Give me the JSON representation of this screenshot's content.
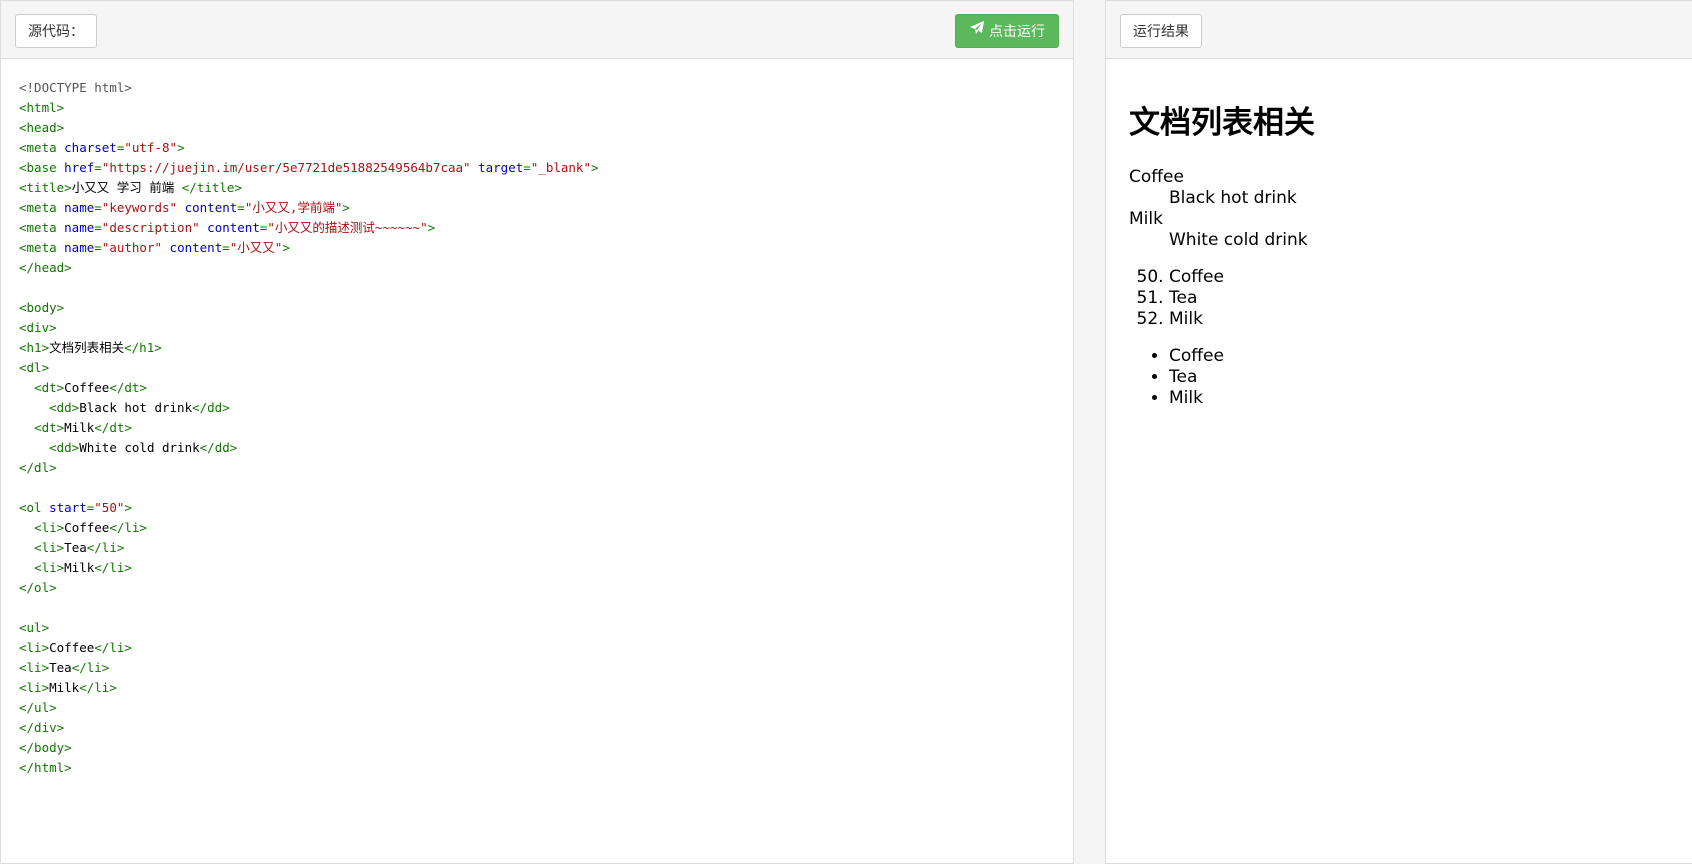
{
  "left_panel": {
    "label_button": "源代码：",
    "run_button": "点击运行",
    "code_lines": [
      [
        [
          "meta",
          "<!DOCTYPE html>"
        ]
      ],
      [
        [
          "tag",
          "<html>"
        ]
      ],
      [
        [
          "tag",
          "<head>"
        ]
      ],
      [
        [
          "tag",
          "<meta "
        ],
        [
          "attr",
          "charset"
        ],
        [
          "tag",
          "="
        ],
        [
          "str",
          "\"utf-8\""
        ],
        [
          "tag",
          ">"
        ]
      ],
      [
        [
          "tag",
          "<base "
        ],
        [
          "attr",
          "href"
        ],
        [
          "tag",
          "="
        ],
        [
          "str",
          "\"https://juejin.im/user/5e7721de51882549564b7caa\""
        ],
        [
          "tag",
          " "
        ],
        [
          "attr",
          "target"
        ],
        [
          "tag",
          "="
        ],
        [
          "str",
          "\"_blank\""
        ],
        [
          "tag",
          ">"
        ]
      ],
      [
        [
          "tag",
          "<title>"
        ],
        [
          "txt",
          "小又又 学习 前端 "
        ],
        [
          "tag",
          "</title>"
        ]
      ],
      [
        [
          "tag",
          "<meta "
        ],
        [
          "attr",
          "name"
        ],
        [
          "tag",
          "="
        ],
        [
          "str",
          "\"keywords\""
        ],
        [
          "tag",
          " "
        ],
        [
          "attr",
          "content"
        ],
        [
          "tag",
          "="
        ],
        [
          "str",
          "\"小又又,学前端\""
        ],
        [
          "tag",
          ">"
        ]
      ],
      [
        [
          "tag",
          "<meta "
        ],
        [
          "attr",
          "name"
        ],
        [
          "tag",
          "="
        ],
        [
          "str",
          "\"description\""
        ],
        [
          "tag",
          " "
        ],
        [
          "attr",
          "content"
        ],
        [
          "tag",
          "="
        ],
        [
          "str",
          "\"小又又的描述测试~~~~~~\""
        ],
        [
          "tag",
          ">"
        ]
      ],
      [
        [
          "tag",
          "<meta "
        ],
        [
          "attr",
          "name"
        ],
        [
          "tag",
          "="
        ],
        [
          "str",
          "\"author\""
        ],
        [
          "tag",
          " "
        ],
        [
          "attr",
          "content"
        ],
        [
          "tag",
          "="
        ],
        [
          "str",
          "\"小又又\""
        ],
        [
          "tag",
          ">"
        ]
      ],
      [
        [
          "tag",
          "</head>"
        ]
      ],
      [],
      [
        [
          "tag",
          "<body>"
        ]
      ],
      [
        [
          "tag",
          "<div>"
        ]
      ],
      [
        [
          "tag",
          "<h1>"
        ],
        [
          "txt",
          "文档列表相关"
        ],
        [
          "tag",
          "</h1>"
        ]
      ],
      [
        [
          "tag",
          "<dl>"
        ]
      ],
      [
        [
          "txt",
          "  "
        ],
        [
          "tag",
          "<dt>"
        ],
        [
          "txt",
          "Coffee"
        ],
        [
          "tag",
          "</dt>"
        ]
      ],
      [
        [
          "txt",
          "    "
        ],
        [
          "tag",
          "<dd>"
        ],
        [
          "txt",
          "Black hot drink"
        ],
        [
          "tag",
          "</dd>"
        ]
      ],
      [
        [
          "txt",
          "  "
        ],
        [
          "tag",
          "<dt>"
        ],
        [
          "txt",
          "Milk"
        ],
        [
          "tag",
          "</dt>"
        ]
      ],
      [
        [
          "txt",
          "    "
        ],
        [
          "tag",
          "<dd>"
        ],
        [
          "txt",
          "White cold drink"
        ],
        [
          "tag",
          "</dd>"
        ]
      ],
      [
        [
          "tag",
          "</dl>"
        ]
      ],
      [],
      [
        [
          "tag",
          "<ol "
        ],
        [
          "attr",
          "start"
        ],
        [
          "tag",
          "="
        ],
        [
          "str",
          "\"50\""
        ],
        [
          "tag",
          ">"
        ]
      ],
      [
        [
          "txt",
          "  "
        ],
        [
          "tag",
          "<li>"
        ],
        [
          "txt",
          "Coffee"
        ],
        [
          "tag",
          "</li>"
        ]
      ],
      [
        [
          "txt",
          "  "
        ],
        [
          "tag",
          "<li>"
        ],
        [
          "txt",
          "Tea"
        ],
        [
          "tag",
          "</li>"
        ]
      ],
      [
        [
          "txt",
          "  "
        ],
        [
          "tag",
          "<li>"
        ],
        [
          "txt",
          "Milk"
        ],
        [
          "tag",
          "</li>"
        ]
      ],
      [
        [
          "tag",
          "</ol>"
        ]
      ],
      [],
      [
        [
          "tag",
          "<ul>"
        ]
      ],
      [
        [
          "tag",
          "<li>"
        ],
        [
          "txt",
          "Coffee"
        ],
        [
          "tag",
          "</li>"
        ]
      ],
      [
        [
          "tag",
          "<li>"
        ],
        [
          "txt",
          "Tea"
        ],
        [
          "tag",
          "</li>"
        ]
      ],
      [
        [
          "tag",
          "<li>"
        ],
        [
          "txt",
          "Milk"
        ],
        [
          "tag",
          "</li>"
        ]
      ],
      [
        [
          "tag",
          "</ul>"
        ]
      ],
      [
        [
          "tag",
          "</div>"
        ]
      ],
      [
        [
          "tag",
          "</body>"
        ]
      ],
      [
        [
          "tag",
          "</html>"
        ]
      ]
    ]
  },
  "right_panel": {
    "label_button": "运行结果",
    "heading": "文档列表相关",
    "definition_list": [
      {
        "term": "Coffee",
        "desc": "Black hot drink"
      },
      {
        "term": "Milk",
        "desc": "White cold drink"
      }
    ],
    "ordered_list": {
      "start": 50,
      "items": [
        "Coffee",
        "Tea",
        "Milk"
      ]
    },
    "unordered_list": [
      "Coffee",
      "Tea",
      "Milk"
    ]
  },
  "colors": {
    "run_button_bg": "#5cb85c",
    "code_tag": "#117700",
    "code_attr": "#0000cc",
    "code_string": "#aa1111"
  }
}
